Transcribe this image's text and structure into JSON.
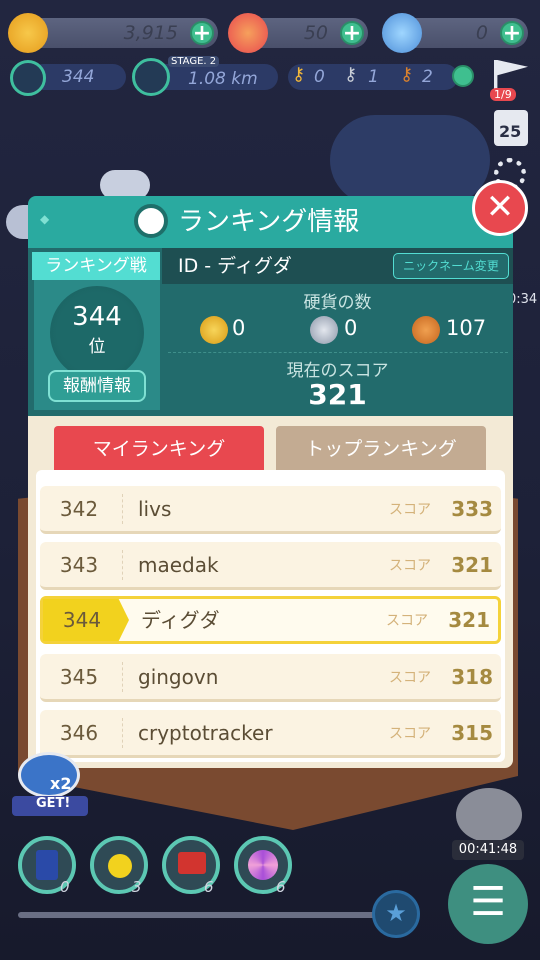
{
  "currency": {
    "gold": {
      "value": "3,915",
      "icon": "gold-coin-icon"
    },
    "red": {
      "value": "50",
      "icon": "red-gem-icon"
    },
    "infinity": {
      "value": "0",
      "icon": "infinity-token-icon"
    }
  },
  "status": {
    "level": "344",
    "stage_label": "STAGE. 2",
    "distance": "1.08 km",
    "keys": [
      "0",
      "1",
      "2"
    ],
    "flag_count": "1/9",
    "calendar_day": "25",
    "side_timer": "0:34"
  },
  "modal": {
    "title": "ランキング情報",
    "rank_tab": "ランキング戦",
    "rank_number": "344",
    "rank_suffix": "位",
    "reward_button": "報酬情報",
    "player_id": "ID - ディグダ",
    "nickname_button": "ニックネーム変更",
    "coins_label": "硬貨の数",
    "coins": [
      {
        "icon": "gold-medal-coin-icon",
        "value": "0"
      },
      {
        "icon": "silver-medal-coin-icon",
        "value": "0"
      },
      {
        "icon": "bronze-medal-coin-icon",
        "value": "107"
      }
    ],
    "score_label": "現在のスコア",
    "score": "321",
    "tabs": {
      "my": "マイランキング",
      "top": "トップランキング"
    },
    "score_word": "スコア",
    "rows": [
      {
        "rank": "342",
        "name": "livs",
        "score": "333"
      },
      {
        "rank": "343",
        "name": "maedak",
        "score": "321"
      },
      {
        "rank": "344",
        "name": "ディグダ",
        "score": "321"
      },
      {
        "rank": "345",
        "name": "gingovn",
        "score": "318"
      },
      {
        "rank": "346",
        "name": "cryptotracker",
        "score": "315"
      }
    ]
  },
  "bottom": {
    "key_bonus": "x2",
    "get_label": "GET!",
    "items": [
      "0",
      "3",
      "6",
      "6"
    ],
    "gift_timer": "00:41:48"
  },
  "colors": {
    "accent": "#2aaaa0",
    "red": "#e8484f",
    "highlight": "#f2d21e",
    "bg": "#1d2138"
  }
}
